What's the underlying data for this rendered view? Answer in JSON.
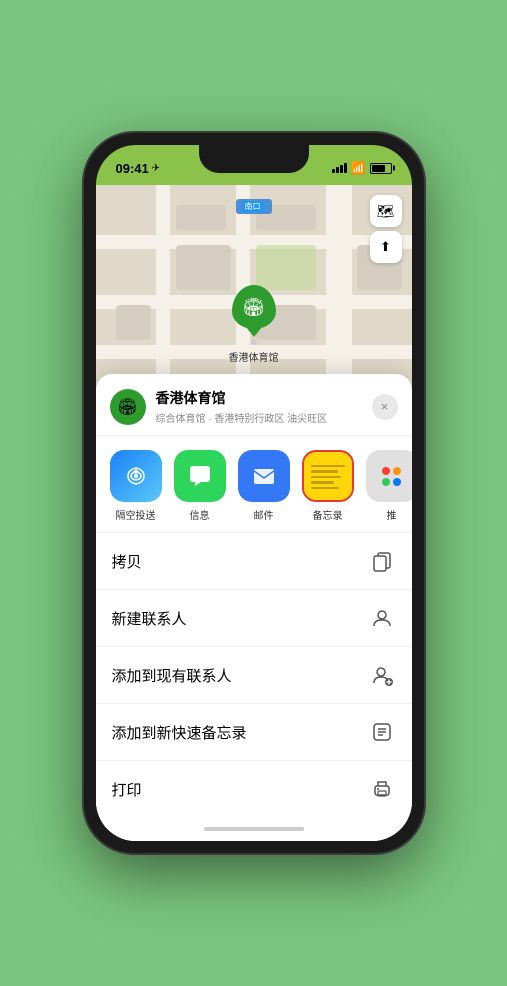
{
  "phone": {
    "status_bar": {
      "time": "09:41",
      "location_arrow": "▶"
    }
  },
  "map": {
    "label": "南口",
    "controls": {
      "layers_icon": "🗺",
      "location_icon": "⬆"
    },
    "marker": {
      "name": "香港体育馆",
      "dot": ""
    }
  },
  "location_card": {
    "name": "香港体育馆",
    "description": "综合体育馆 · 香港特别行政区 油尖旺区",
    "close_label": "×"
  },
  "share_items": [
    {
      "id": "airdrop",
      "label": "隔空投送",
      "icon": "📡"
    },
    {
      "id": "messages",
      "label": "信息",
      "icon": "💬"
    },
    {
      "id": "mail",
      "label": "邮件",
      "icon": "✉"
    },
    {
      "id": "notes",
      "label": "备忘录",
      "icon": ""
    },
    {
      "id": "more",
      "label": "推",
      "icon": ""
    }
  ],
  "actions": [
    {
      "id": "copy",
      "label": "拷贝",
      "icon": "⎘"
    },
    {
      "id": "new-contact",
      "label": "新建联系人",
      "icon": "👤"
    },
    {
      "id": "add-existing",
      "label": "添加到现有联系人",
      "icon": "👤"
    },
    {
      "id": "add-note",
      "label": "添加到新快速备忘录",
      "icon": "🔲"
    },
    {
      "id": "print",
      "label": "打印",
      "icon": "🖨"
    }
  ]
}
